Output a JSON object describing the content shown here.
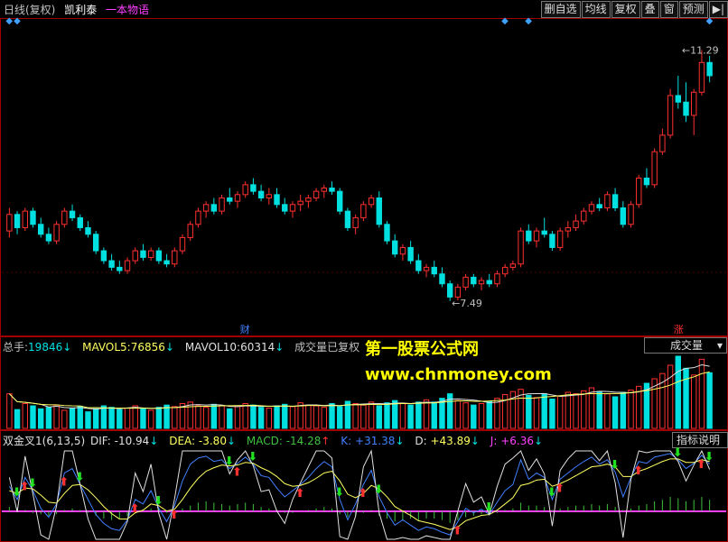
{
  "header": {
    "period": "日线(复权)",
    "stock": "凯利泰",
    "tag": "一本物语"
  },
  "toolbar": [
    "删自选",
    "均线",
    "复权",
    "叠",
    "窗",
    "预测",
    "▶|"
  ],
  "price_labels": {
    "high": "11.29",
    "low": "7.49"
  },
  "markers": {
    "cai": "财",
    "zhang": "涨"
  },
  "volume": {
    "total_label": "总手:",
    "total_value": "19846",
    "mavol5_label": "MAVOL5:",
    "mavol5_value": "76856",
    "mavol10_label": "MAVOL10:",
    "mavol10_value": "60314",
    "note": "成交量已复权",
    "selector": "成交量"
  },
  "indicator": {
    "name": "双金叉1(6,13,5)",
    "dif_label": "DIF:",
    "dif_value": "-10.94",
    "dea_label": "DEA:",
    "dea_value": "-3.80",
    "macd_label": "MACD:",
    "macd_value": "-14.28",
    "k_label": "K:",
    "k_value": "+31.38",
    "d_label": "D:",
    "d_value": "+43.89",
    "j_label": "J:",
    "j_value": "+6.36",
    "help": "指标说明"
  },
  "watermark": {
    "line1": "第一股票公式网",
    "line2": "www.chnmoney.com"
  },
  "colors": {
    "up": "#ff3030",
    "down": "#00e0e0",
    "frame": "#a00000",
    "watermark": "#ffff00"
  },
  "chart_data": {
    "type": "candlestick",
    "price_range": [
      7.2,
      11.5
    ],
    "candles": [
      [
        8.55,
        8.9,
        8.45,
        8.8
      ],
      [
        8.8,
        8.85,
        8.5,
        8.6
      ],
      [
        8.6,
        8.9,
        8.55,
        8.85
      ],
      [
        8.85,
        8.9,
        8.6,
        8.65
      ],
      [
        8.65,
        8.75,
        8.45,
        8.5
      ],
      [
        8.5,
        8.6,
        8.35,
        8.4
      ],
      [
        8.4,
        8.7,
        8.35,
        8.65
      ],
      [
        8.65,
        8.9,
        8.6,
        8.85
      ],
      [
        8.85,
        8.95,
        8.7,
        8.75
      ],
      [
        8.75,
        8.8,
        8.55,
        8.6
      ],
      [
        8.6,
        8.7,
        8.45,
        8.5
      ],
      [
        8.5,
        8.55,
        8.2,
        8.25
      ],
      [
        8.25,
        8.3,
        8.05,
        8.1
      ],
      [
        8.1,
        8.2,
        7.95,
        8.0
      ],
      [
        8.0,
        8.1,
        7.9,
        7.95
      ],
      [
        7.95,
        8.15,
        7.9,
        8.1
      ],
      [
        8.1,
        8.3,
        8.05,
        8.25
      ],
      [
        8.25,
        8.35,
        8.1,
        8.15
      ],
      [
        8.15,
        8.3,
        8.1,
        8.25
      ],
      [
        8.25,
        8.3,
        8.05,
        8.1
      ],
      [
        8.1,
        8.2,
        8.0,
        8.05
      ],
      [
        8.05,
        8.3,
        8.0,
        8.25
      ],
      [
        8.25,
        8.5,
        8.2,
        8.45
      ],
      [
        8.45,
        8.7,
        8.4,
        8.65
      ],
      [
        8.65,
        8.9,
        8.6,
        8.85
      ],
      [
        8.85,
        9.0,
        8.75,
        8.95
      ],
      [
        8.95,
        9.05,
        8.8,
        8.85
      ],
      [
        8.85,
        9.1,
        8.8,
        9.05
      ],
      [
        9.05,
        9.2,
        8.95,
        9.0
      ],
      [
        9.0,
        9.15,
        8.9,
        9.1
      ],
      [
        9.1,
        9.3,
        9.05,
        9.25
      ],
      [
        9.25,
        9.35,
        9.1,
        9.15
      ],
      [
        9.15,
        9.25,
        9.0,
        9.05
      ],
      [
        9.05,
        9.2,
        8.95,
        9.1
      ],
      [
        9.1,
        9.2,
        8.9,
        8.95
      ],
      [
        8.95,
        9.05,
        8.8,
        8.85
      ],
      [
        8.85,
        9.0,
        8.75,
        8.95
      ],
      [
        8.95,
        9.1,
        8.85,
        9.0
      ],
      [
        9.0,
        9.1,
        8.9,
        9.05
      ],
      [
        9.05,
        9.2,
        9.0,
        9.15
      ],
      [
        9.15,
        9.25,
        9.05,
        9.2
      ],
      [
        9.2,
        9.3,
        9.1,
        9.15
      ],
      [
        9.15,
        9.2,
        8.8,
        8.85
      ],
      [
        8.85,
        8.9,
        8.55,
        8.6
      ],
      [
        8.6,
        8.8,
        8.5,
        8.75
      ],
      [
        8.75,
        9.0,
        8.7,
        8.95
      ],
      [
        8.95,
        9.1,
        8.9,
        9.05
      ],
      [
        9.05,
        9.15,
        8.6,
        8.65
      ],
      [
        8.65,
        8.7,
        8.35,
        8.4
      ],
      [
        8.4,
        8.5,
        8.15,
        8.2
      ],
      [
        8.2,
        8.35,
        8.1,
        8.3
      ],
      [
        8.3,
        8.4,
        8.05,
        8.1
      ],
      [
        8.1,
        8.2,
        7.9,
        7.95
      ],
      [
        7.95,
        8.05,
        7.85,
        8.0
      ],
      [
        8.0,
        8.1,
        7.85,
        7.9
      ],
      [
        7.9,
        8.0,
        7.7,
        7.75
      ],
      [
        7.75,
        7.8,
        7.49,
        7.55
      ],
      [
        7.55,
        7.75,
        7.5,
        7.7
      ],
      [
        7.7,
        7.9,
        7.65,
        7.85
      ],
      [
        7.85,
        7.9,
        7.7,
        7.75
      ],
      [
        7.75,
        7.85,
        7.65,
        7.8
      ],
      [
        7.8,
        7.9,
        7.7,
        7.75
      ],
      [
        7.75,
        7.95,
        7.7,
        7.9
      ],
      [
        7.9,
        8.05,
        7.85,
        8.0
      ],
      [
        8.0,
        8.1,
        7.95,
        8.05
      ],
      [
        8.05,
        8.6,
        8.0,
        8.55
      ],
      [
        8.55,
        8.65,
        8.35,
        8.4
      ],
      [
        8.4,
        8.6,
        8.3,
        8.55
      ],
      [
        8.55,
        8.75,
        8.45,
        8.5
      ],
      [
        8.5,
        8.55,
        8.25,
        8.3
      ],
      [
        8.3,
        8.6,
        8.25,
        8.55
      ],
      [
        8.55,
        8.7,
        8.45,
        8.6
      ],
      [
        8.6,
        8.8,
        8.55,
        8.7
      ],
      [
        8.7,
        8.9,
        8.65,
        8.85
      ],
      [
        8.85,
        9.0,
        8.8,
        8.95
      ],
      [
        8.95,
        9.05,
        8.85,
        8.9
      ],
      [
        8.9,
        9.15,
        8.85,
        9.1
      ],
      [
        9.1,
        9.2,
        8.85,
        8.9
      ],
      [
        8.9,
        9.0,
        8.6,
        8.65
      ],
      [
        8.65,
        9.0,
        8.6,
        8.95
      ],
      [
        8.95,
        9.4,
        8.9,
        9.35
      ],
      [
        9.35,
        9.5,
        9.2,
        9.25
      ],
      [
        9.25,
        9.8,
        9.2,
        9.75
      ],
      [
        9.75,
        10.1,
        9.7,
        10.0
      ],
      [
        10.0,
        10.7,
        9.95,
        10.6
      ],
      [
        10.6,
        10.9,
        10.4,
        10.5
      ],
      [
        10.5,
        10.8,
        10.2,
        10.3
      ],
      [
        10.3,
        10.7,
        10.0,
        10.65
      ],
      [
        10.65,
        11.29,
        10.6,
        11.1
      ],
      [
        11.1,
        11.2,
        10.8,
        10.9
      ]
    ],
    "volume": [
      46,
      25,
      33,
      30,
      26,
      28,
      31,
      24,
      27,
      29,
      22,
      26,
      30,
      28,
      25,
      27,
      30,
      26,
      24,
      28,
      31,
      29,
      33,
      35,
      30,
      28,
      32,
      30,
      26,
      29,
      33,
      31,
      28,
      27,
      30,
      32,
      29,
      34,
      31,
      30,
      28,
      33,
      29,
      36,
      33,
      31,
      35,
      30,
      34,
      37,
      33,
      31,
      35,
      38,
      35,
      40,
      46,
      37,
      34,
      31,
      33,
      36,
      40,
      45,
      49,
      52,
      44,
      41,
      46,
      39,
      43,
      48,
      46,
      50,
      54,
      49,
      46,
      42,
      48,
      51,
      56,
      60,
      66,
      73,
      84,
      96,
      80,
      71,
      92,
      74
    ],
    "macd_hist": [
      3,
      2,
      1,
      -1,
      -2,
      -3,
      -2,
      1,
      2,
      1,
      -1,
      -3,
      -5,
      -6,
      -5,
      -3,
      -1,
      1,
      2,
      1,
      -1,
      -1,
      2,
      4,
      6,
      7,
      6,
      5,
      4,
      5,
      6,
      5,
      3,
      2,
      1,
      -1,
      -1,
      0,
      1,
      2,
      3,
      2,
      -2,
      -4,
      -3,
      -1,
      1,
      -3,
      -5,
      -7,
      -6,
      -5,
      -6,
      -5,
      -5,
      -6,
      -8,
      -6,
      -4,
      -3,
      -2,
      -2,
      -1,
      1,
      2,
      6,
      4,
      4,
      3,
      1,
      2,
      3,
      4,
      4,
      5,
      4,
      5,
      3,
      1,
      2,
      4,
      5,
      7,
      8,
      10,
      9,
      7,
      8,
      10,
      8
    ],
    "k": [
      60,
      45,
      70,
      55,
      35,
      25,
      40,
      75,
      80,
      62,
      45,
      28,
      18,
      12,
      10,
      22,
      45,
      40,
      55,
      35,
      20,
      38,
      66,
      85,
      92,
      94,
      88,
      90,
      80,
      86,
      93,
      85,
      72,
      70,
      58,
      48,
      55,
      62,
      70,
      80,
      88,
      82,
      45,
      22,
      40,
      62,
      78,
      48,
      30,
      16,
      22,
      16,
      10,
      14,
      12,
      8,
      5,
      20,
      35,
      30,
      34,
      28,
      42,
      55,
      62,
      90,
      68,
      75,
      70,
      45,
      68,
      75,
      82,
      88,
      93,
      85,
      90,
      76,
      48,
      70,
      88,
      86,
      93,
      95,
      97,
      90,
      80,
      86,
      95,
      85
    ],
    "d": [
      55,
      52,
      58,
      57,
      50,
      42,
      41,
      52,
      61,
      62,
      56,
      47,
      37,
      29,
      23,
      23,
      30,
      33,
      40,
      38,
      32,
      34,
      45,
      58,
      69,
      77,
      81,
      84,
      83,
      84,
      87,
      86,
      81,
      77,
      71,
      63,
      60,
      61,
      64,
      69,
      75,
      77,
      66,
      51,
      47,
      52,
      61,
      57,
      48,
      37,
      32,
      27,
      21,
      19,
      17,
      14,
      11,
      14,
      21,
      24,
      27,
      28,
      33,
      40,
      47,
      61,
      63,
      67,
      68,
      60,
      63,
      67,
      72,
      77,
      82,
      83,
      85,
      82,
      71,
      71,
      77,
      80,
      84,
      88,
      91,
      91,
      87,
      87,
      90,
      88
    ]
  }
}
